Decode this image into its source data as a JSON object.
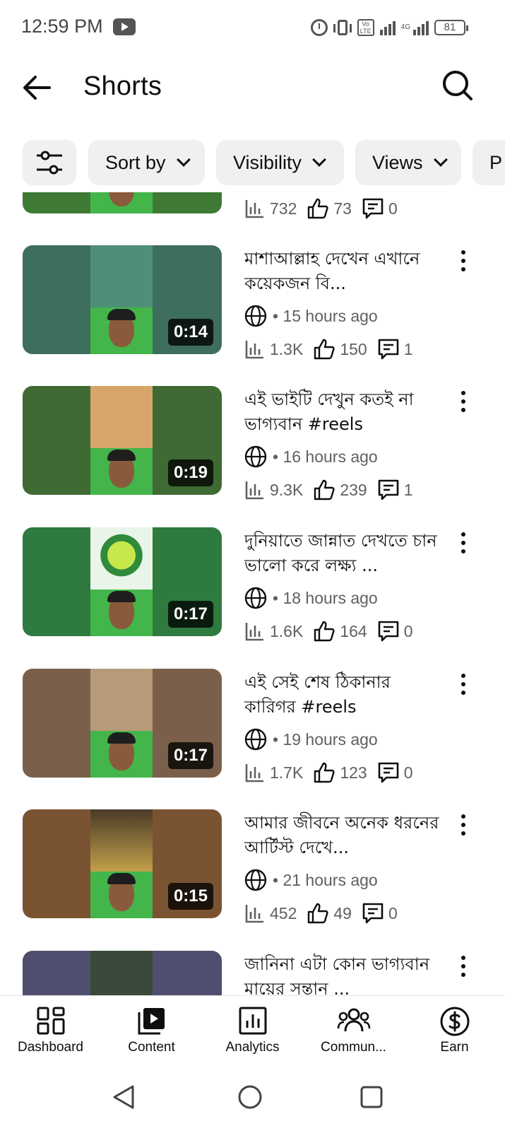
{
  "status_bar": {
    "time": "12:59 PM",
    "battery": "81",
    "volte": "Vo LTE",
    "network": "4G"
  },
  "header": {
    "title": "Shorts",
    "back_icon": "arrow-left-icon",
    "search_icon": "search-icon"
  },
  "chips": [
    {
      "label": "",
      "icon": "filter-sliders-icon"
    },
    {
      "label": "Sort by"
    },
    {
      "label": "Visibility"
    },
    {
      "label": "Views"
    },
    {
      "label": "P"
    }
  ],
  "partial_item": {
    "views": "732",
    "likes": "73",
    "comments": "0"
  },
  "videos": [
    {
      "title": "মাশাআল্লাহ দেখেন এখানে কয়েকজন বি...",
      "duration": "0:14",
      "time": "• 15 hours ago",
      "views": "1.3K",
      "likes": "150",
      "comments": "1",
      "bg": "#3e6e5c",
      "top_color": "#4f8f78"
    },
    {
      "title": "এই ভাইটি দেখুন কতই না ভাগ্যবান #reels",
      "duration": "0:19",
      "time": "• 16 hours ago",
      "views": "9.3K",
      "likes": "239",
      "comments": "1",
      "bg": "#3f6a33",
      "top_color": "#d7a56a"
    },
    {
      "title": "দুনিয়াতে জান্নাত দেখতে চান ভালো করে লক্ষ্য ...",
      "duration": "0:17",
      "time": "• 18 hours ago",
      "views": "1.6K",
      "likes": "164",
      "comments": "0",
      "bg": "#2f7a3e",
      "top_color": "#a8d84a"
    },
    {
      "title": "এই সেই শেষ ঠিকানার কারিগর #reels",
      "duration": "0:17",
      "time": "• 19 hours ago",
      "views": "1.7K",
      "likes": "123",
      "comments": "0",
      "bg": "#7a5f4a",
      "top_color": "#b79a78"
    },
    {
      "title": "আমার জীবনে অনেক ধরনের আর্টিস্ট দেখে...",
      "duration": "0:15",
      "time": "• 21 hours ago",
      "views": "452",
      "likes": "49",
      "comments": "0",
      "bg": "#7a5432",
      "top_color": "#c2a04a"
    },
    {
      "title": "জানিনা এটা কোন ভাগ্যবান মায়ের সন্তান ...",
      "duration": "",
      "time": "",
      "views": "",
      "likes": "",
      "comments": "",
      "bg": "#4f4e6e",
      "top_color": "#3a4a3a"
    }
  ],
  "bottom_nav": [
    {
      "label": "Dashboard",
      "icon": "dashboard-icon"
    },
    {
      "label": "Content",
      "icon": "content-play-icon"
    },
    {
      "label": "Analytics",
      "icon": "analytics-icon"
    },
    {
      "label": "Commun...",
      "icon": "community-icon"
    },
    {
      "label": "Earn",
      "icon": "earn-dollar-icon"
    }
  ],
  "system_nav": [
    "back-triangle-icon",
    "home-circle-icon",
    "recents-square-icon"
  ]
}
